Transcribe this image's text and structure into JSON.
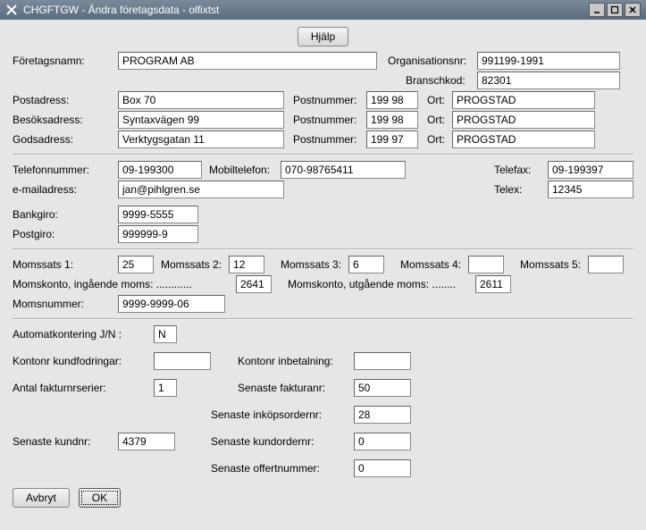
{
  "window": {
    "title": "CHGFTGW - Ändra företagsdata - olfixtst"
  },
  "buttons": {
    "help": "Hjälp",
    "cancel": "Avbryt",
    "ok": "OK"
  },
  "labels": {
    "foretagsnamn": "Företagsnamn:",
    "organisationsnr": "Organisationsnr:",
    "branschkod": "Branschkod:",
    "postadress": "Postadress:",
    "besoksadress": "Besöksadress:",
    "godsadress": "Godsadress:",
    "postnummer": "Postnummer:",
    "ort": "Ort:",
    "telefonnummer": "Telefonnummer:",
    "mobiltelefon": "Mobiltelefon:",
    "telefax": "Telefax:",
    "emailadress": "e-mailadress:",
    "telex": "Telex:",
    "bankgiro": "Bankgiro:",
    "postgiro": "Postgiro:",
    "momssats1": "Momssats 1:",
    "momssats2": "Momssats 2:",
    "momssats3": "Momssats 3:",
    "momssats4": "Momssats 4:",
    "momssats5": "Momssats 5:",
    "momskonto_in": "Momskonto, ingående moms: ............",
    "momskonto_ut": "Momskonto, utgående moms: ........",
    "momsnummer": "Momsnummer:",
    "automatkontering": "Automatkontering J/N :",
    "kontonr_kundfodringar": "Kontonr kundfodringar:",
    "kontonr_inbetalning": "Kontonr inbetalning:",
    "antal_fakturnrserier": "Antal fakturnrserier:",
    "senaste_fakturanr": "Senaste fakturanr:",
    "senaste_inkopsordernr": "Senaste inköpsordernr:",
    "senaste_kundnr": "Senaste kundnr:",
    "senaste_kundordernr": "Senaste kundordernr:",
    "senaste_offertnummer": "Senaste offertnummer:"
  },
  "values": {
    "foretagsnamn": "PROGRAM AB",
    "organisationsnr": "991199-1991",
    "branschkod": "82301",
    "postadress": "Box 70",
    "besoksadress": "Syntaxvägen 99",
    "godsadress": "Verktygsgatan 11",
    "postnr1": "199 98",
    "ort1": "PROGSTAD",
    "postnr2": "199 98",
    "ort2": "PROGSTAD",
    "postnr3": "199 97",
    "ort3": "PROGSTAD",
    "telefon": "09-199300",
    "mobil": "070-98765411",
    "telefax": "09-199397",
    "email": "jan@pihlgren.se",
    "telex": "12345",
    "bankgiro": "9999-5555",
    "postgiro": "999999-9",
    "moms1": "25",
    "moms2": "12",
    "moms3": "6",
    "moms4": "",
    "moms5": "",
    "momskonto_in": "2641",
    "momskonto_ut": "2611",
    "momsnummer": "9999-9999-06",
    "automatkontering": "N",
    "kontonr_kundfodringar": "",
    "kontonr_inbetalning": "",
    "antal_fakturnrserier": "1",
    "senaste_fakturanr": "50",
    "senaste_inkopsordernr": "28",
    "senaste_kundnr": "4379",
    "senaste_kundordernr": "0",
    "senaste_offertnummer": "0"
  }
}
